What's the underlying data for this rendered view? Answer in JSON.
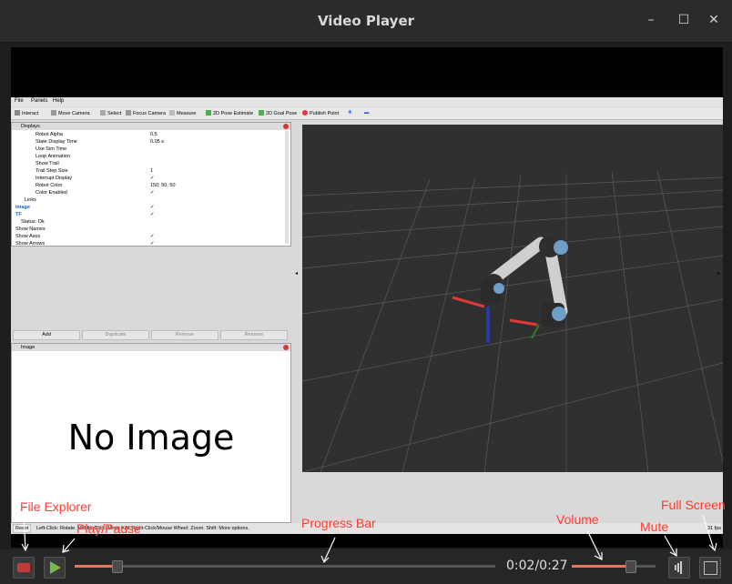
{
  "window": {
    "title": "Video Player",
    "minimize_glyph": "–",
    "maximize_glyph": "☐",
    "close_glyph": "✕"
  },
  "rviz": {
    "menu": [
      "File",
      "Panels",
      "Help"
    ],
    "tools": [
      "Interact",
      "Move Camera",
      "Select",
      "Focus Camera",
      "Measure",
      "2D Pose Estimate",
      "2D Goal Pose",
      "Publish Point"
    ],
    "displays_title": "Displays",
    "properties": [
      {
        "name": "Robot Alpha",
        "value": "0.5"
      },
      {
        "name": "State Display Time",
        "value": "0.05 s"
      },
      {
        "name": "Use Sim Time",
        "value": ""
      },
      {
        "name": "Loop Animation",
        "value": ""
      },
      {
        "name": "Show Trail",
        "value": ""
      },
      {
        "name": "Trail Step Size",
        "value": "1"
      },
      {
        "name": "Interrupt Display",
        "value": "✓"
      },
      {
        "name": "Robot Color",
        "value": "150; 50; 50"
      },
      {
        "name": "Color Enabled",
        "value": "✓"
      },
      {
        "name": "Links",
        "value": ""
      },
      {
        "name": "Image",
        "value": "✓"
      },
      {
        "name": "TF",
        "value": "✓"
      },
      {
        "name": "Status: Ok",
        "value": ""
      },
      {
        "name": "Show Names",
        "value": ""
      },
      {
        "name": "Show Axes",
        "value": "✓"
      },
      {
        "name": "Show Arrows",
        "value": "✓"
      }
    ],
    "buttons": [
      "Add",
      "Duplicate",
      "Remove",
      "Rename"
    ],
    "image_panel_title": "Image",
    "no_image_text": "No Image",
    "status": {
      "reset": "Reset",
      "hint": "Left-Click: Rotate. Middle-Click: Move X/Y. Right-Click/Mouse Wheel: Zoom. Shift: More options.",
      "fps": "31 fps"
    }
  },
  "player": {
    "time": "0:02/0:27",
    "progress_fraction": 0.1,
    "volume_fraction": 0.7
  },
  "annotations": {
    "file_explorer": "File Explorer",
    "play_pause": "Play/Pause",
    "progress_bar": "Progress Bar",
    "volume": "Volume",
    "mute": "Mute",
    "full_screen": "Full Screen"
  },
  "colors": {
    "accent": "#e8765a",
    "annotation": "#ff3b30",
    "play": "#7ab648"
  }
}
